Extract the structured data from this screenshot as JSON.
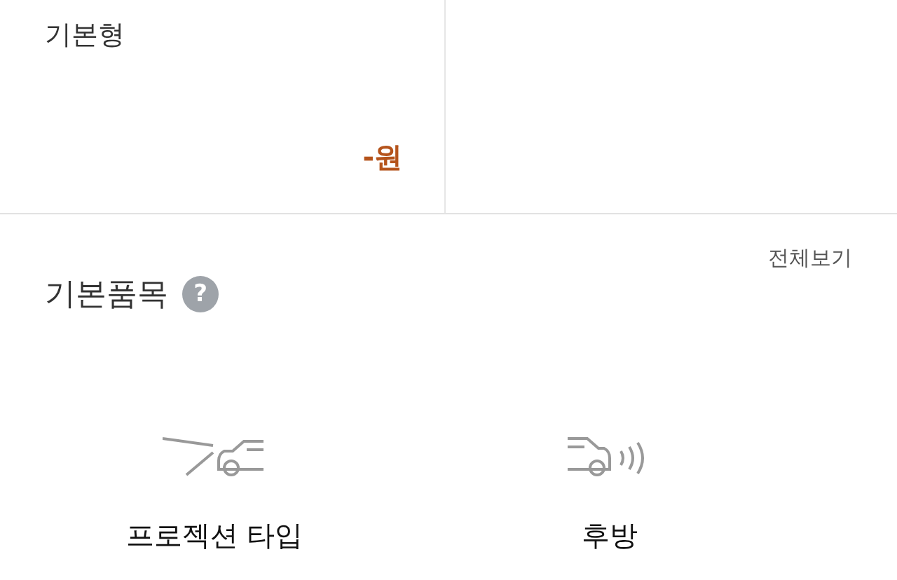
{
  "plans": [
    {
      "name": "기본형",
      "price": "-원"
    }
  ],
  "section": {
    "title": "기본품목",
    "help": "?",
    "view_all": "전체보기"
  },
  "items": [
    {
      "kind": "projection",
      "label": "프로젝션 타입"
    },
    {
      "kind": "rear-sensor",
      "label": "후방"
    }
  ]
}
